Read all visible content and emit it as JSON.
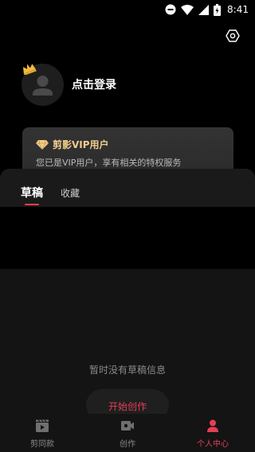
{
  "status_bar": {
    "time": "8:41"
  },
  "profile": {
    "login_text": "点击登录"
  },
  "vip_card": {
    "title": "剪影VIP用户",
    "subtitle": "您已是VIP用户，享有相关的特权服务"
  },
  "tabs": [
    {
      "label": "草稿",
      "active": true
    },
    {
      "label": "收藏",
      "active": false
    }
  ],
  "empty_state": {
    "message": "暂时没有草稿信息",
    "button_label": "开始创作"
  },
  "bottom_nav": [
    {
      "label": "剪同款",
      "icon": "clapperboard-icon",
      "active": false
    },
    {
      "label": "创作",
      "icon": "video-camera-icon",
      "active": false
    },
    {
      "label": "个人中心",
      "icon": "person-icon",
      "active": true
    }
  ],
  "colors": {
    "accent": "#e53e56",
    "vip_gold": "#f1cb8c",
    "background": "#000000"
  }
}
